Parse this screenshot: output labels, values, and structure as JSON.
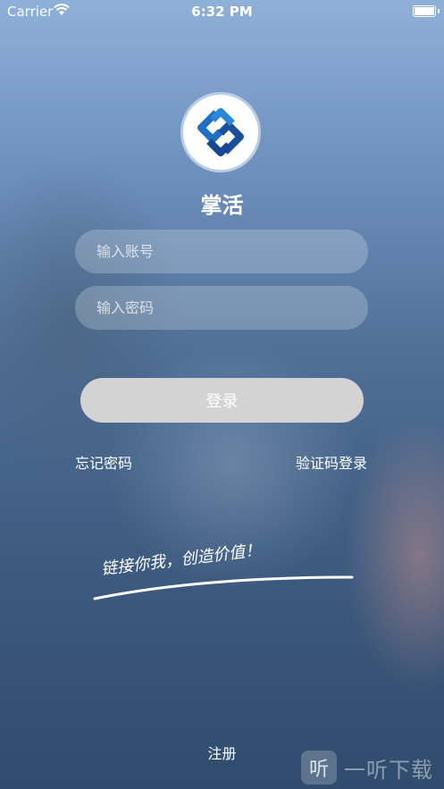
{
  "status_bar": {
    "carrier": "Carrier",
    "time": "6:32 PM"
  },
  "app": {
    "name": "掌活",
    "logo_icon": "chain-link-icon",
    "logo_colors": [
      "#1f6fc4",
      "#1a4f9c"
    ]
  },
  "login_form": {
    "account_placeholder": "输入账号",
    "password_placeholder": "输入密码",
    "login_button": "登录",
    "forgot_password": "忘记密码",
    "sms_login": "验证码登录"
  },
  "slogan": "链接你我，创造价值！",
  "register": "注册",
  "watermark": {
    "icon_glyph": "听",
    "text": "一听下载"
  }
}
